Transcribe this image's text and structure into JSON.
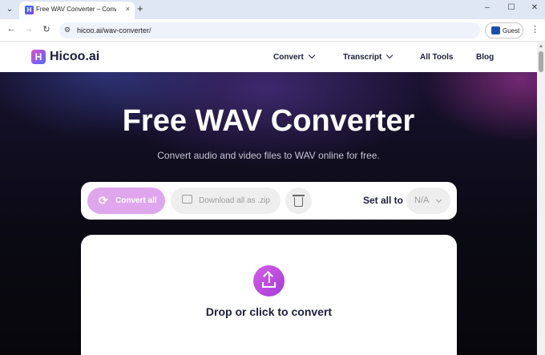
{
  "browser": {
    "tab_title": "Free WAV Converter – Convert a",
    "tab_close": "×",
    "new_tab": "+",
    "url": "hicoo.ai/wav-converter/",
    "profile_label": "Guest",
    "window_controls": {
      "minimize": "–",
      "maximize": "☐",
      "close": "✕"
    },
    "nav_icons": [
      "arrow-back-icon",
      "arrow-forward-icon",
      "reload-icon"
    ]
  },
  "site": {
    "logo_text": "Hicoo.ai",
    "logo_mark": "H",
    "menu": {
      "convert": "Convert",
      "transcript": "Transcript",
      "all_tools": "All Tools",
      "blog": "Blog"
    }
  },
  "hero": {
    "title": "Free WAV Converter",
    "subtitle": "Convert audio and video files to WAV online for free."
  },
  "actions": {
    "convert_all": "Convert all",
    "download_all": "Download all as .zip",
    "set_all_label": "Set all to",
    "set_all_value": "N/A"
  },
  "dropzone": {
    "label": "Drop or click to convert"
  },
  "colors": {
    "accent": "#dfa6ee",
    "upload_button": "#c04fe0",
    "hero_bg": "#0b0a14"
  }
}
